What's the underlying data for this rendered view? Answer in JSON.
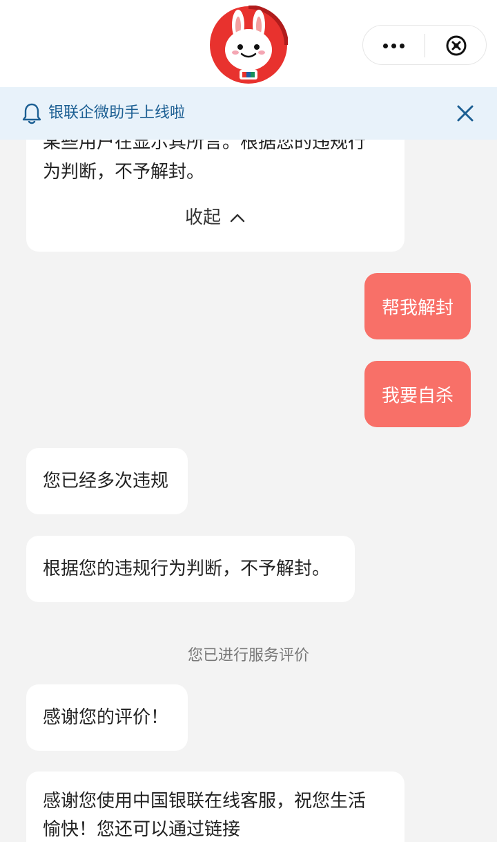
{
  "header": {
    "mascot_icon": "rabbit-mascot-icon",
    "more_icon": "more-dots-icon",
    "close_icon": "close-circle-icon"
  },
  "notice": {
    "text": "银联企微助手上线啦",
    "bell_icon": "bell-icon",
    "dismiss_icon": "close-icon"
  },
  "messages": {
    "m0_line1_partial": "某些用户在显示其所言。根据您的违规行",
    "m0_line2": "为判断，不予解封。",
    "collapse_label": "收起",
    "u1": "帮我解封",
    "u2": "我要自杀",
    "b1": "您已经多次违规",
    "b2": "根据您的违规行为判断，不予解封。",
    "system": "您已进行服务评价",
    "b3": "感谢您的评价！",
    "b4_line1": "感谢您使用中国银联在线客服，祝您生活",
    "b4_line2": "愉快！您还可以通过链接"
  },
  "colors": {
    "user_bubble": "#f87068",
    "notice_bg": "#e8f2fa",
    "notice_text": "#1c5f93",
    "page_bg": "#f3f3f3"
  }
}
